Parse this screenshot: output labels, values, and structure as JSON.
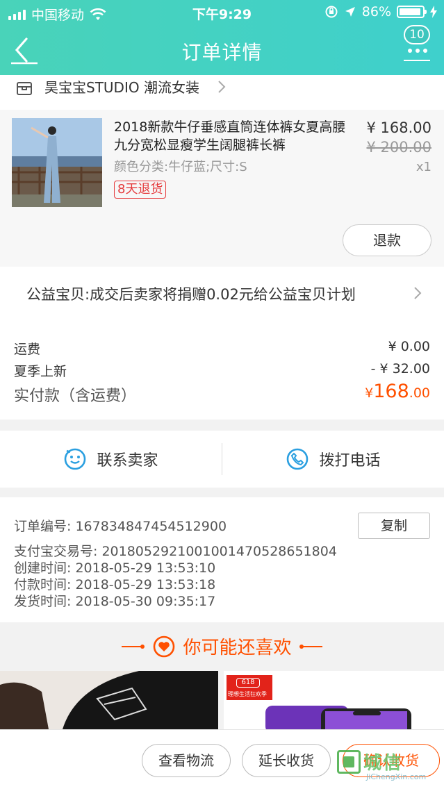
{
  "status_bar": {
    "carrier": "中国移动",
    "time": "下午9:29",
    "battery": "86%"
  },
  "nav": {
    "title": "订单详情",
    "badge": "10"
  },
  "shop": {
    "name": "昊宝宝STUDIO 潮流女装"
  },
  "product": {
    "title": "2018新款牛仔垂感直筒连体裤女夏高腰九分宽松显瘦学生阔腿裤长裤",
    "sku": "颜色分类:牛仔蓝;尺寸:S",
    "tag": "8天退货",
    "price": "¥ 168.00",
    "original_price": "¥ 200.00",
    "qty": "x1",
    "refund_button": "退款"
  },
  "charity": {
    "text": "公益宝贝:成交后卖家将捐赠0.02元给公益宝贝计划"
  },
  "fees": {
    "shipping_label": "运费",
    "shipping_value": "¥ 0.00",
    "discount_label": "夏季上新",
    "discount_value": "- ¥ 32.00",
    "total_label": "实付款（含运费）",
    "total_currency": "¥",
    "total_int": "168",
    "total_dec": ".00"
  },
  "contact": {
    "seller": "联系卖家",
    "call": "拨打电话"
  },
  "order_info": {
    "order_no": "订单编号:   1678348474545129​00",
    "alipay_no": "支付宝交易号:   2018052921001001470528651804",
    "created": "创建时间:   2018-05-29 13:53:10",
    "paid": "付款时间:   2018-05-29 13:53:18",
    "shipped": "发货时间:   2018-05-30 09:35:17",
    "copy_button": "复制"
  },
  "recommend": {
    "title": "你可能还喜欢",
    "promo_badge": "618",
    "promo_slogan": "理想生活狂欢季"
  },
  "bottom": {
    "logistics": "查看物流",
    "extend": "延长收货",
    "confirm": "确认收货"
  },
  "watermark": {
    "name": "城信",
    "url": "JiChengXin.com"
  },
  "colors": {
    "header": "#45d2c2",
    "accent": "#ff5000",
    "tag_red": "#e5393b"
  }
}
